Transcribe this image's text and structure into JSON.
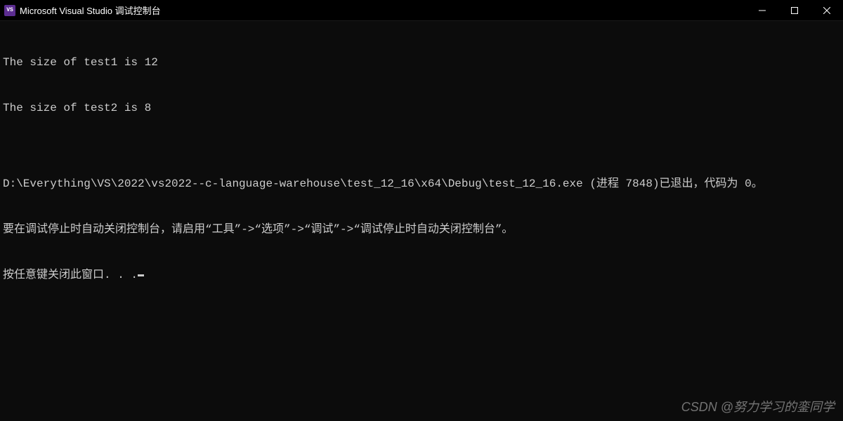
{
  "titlebar": {
    "icon_label": "VS",
    "title": "Microsoft Visual Studio 调试控制台"
  },
  "console": {
    "lines": [
      "The size of test1 is 12",
      "The size of test2 is 8",
      "",
      "D:\\Everything\\VS\\2022\\vs2022--c-language-warehouse\\test_12_16\\x64\\Debug\\test_12_16.exe (进程 7848)已退出，代码为 0。",
      "要在调试停止时自动关闭控制台，请启用“工具”->“选项”->“调试”->“调试停止时自动关闭控制台”。",
      "按任意键关闭此窗口. . ."
    ]
  },
  "watermark": "CSDN @努力学习的銮同学"
}
